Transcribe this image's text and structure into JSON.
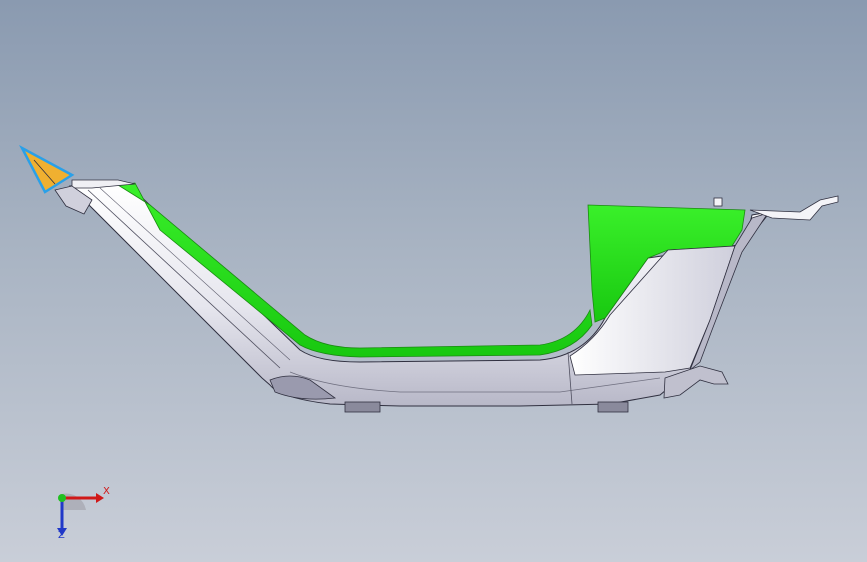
{
  "viewport": {
    "background_top": "#8a9ab0",
    "background_bottom": "#c9ced8"
  },
  "model": {
    "body_color": "#e8e8f0",
    "edge_color": "#303040",
    "highlight_color": "#22e01a",
    "end_cap_color": "#f0b030",
    "end_cap_edge": "#2aa0e8"
  },
  "triad": {
    "x_label": "X",
    "z_label": "Z",
    "x_color": "#d01818",
    "y_color": "#20c020",
    "z_color": "#2038c8"
  }
}
